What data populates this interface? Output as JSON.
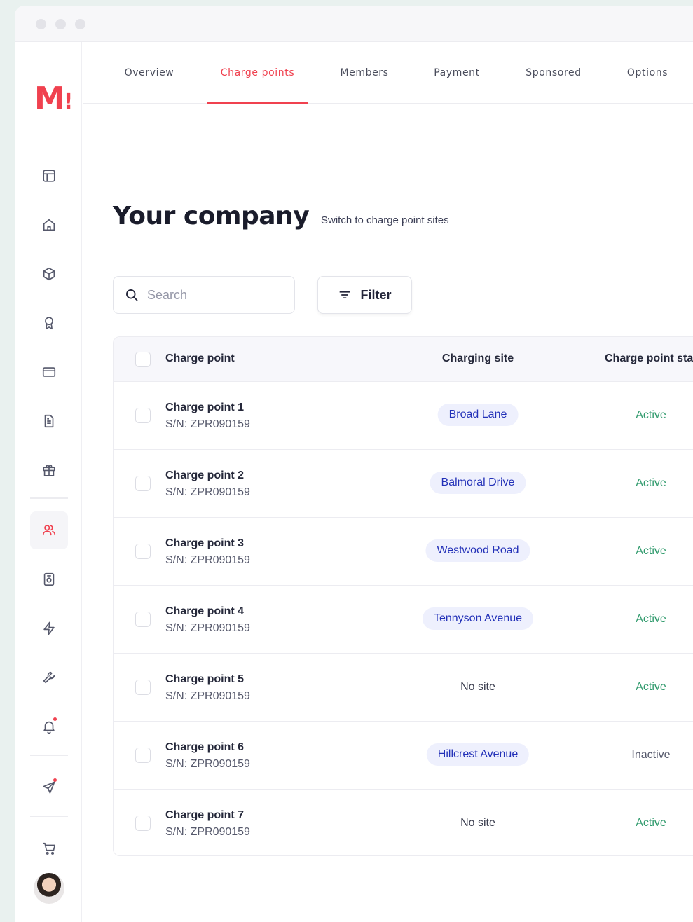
{
  "window": {
    "dot_count": 3
  },
  "brand": {
    "logo_text": "M",
    "logo_mark": "!",
    "accent_color": "#f0414f"
  },
  "sidebar": {
    "icons": [
      {
        "name": "layout-icon"
      },
      {
        "name": "home-icon"
      },
      {
        "name": "cube-icon"
      },
      {
        "name": "award-icon"
      },
      {
        "name": "card-icon"
      },
      {
        "name": "document-icon"
      },
      {
        "name": "gift-icon"
      },
      {
        "name": "users-icon",
        "active": true
      },
      {
        "name": "charger-icon"
      },
      {
        "name": "lightning-icon"
      },
      {
        "name": "wrench-icon"
      },
      {
        "name": "bell-icon",
        "notification": true
      },
      {
        "name": "send-icon",
        "notification": true
      },
      {
        "name": "cart-icon"
      }
    ]
  },
  "tabs": [
    {
      "label": "Overview",
      "active": false
    },
    {
      "label": "Charge points",
      "active": true
    },
    {
      "label": "Members",
      "active": false
    },
    {
      "label": "Payment",
      "active": false
    },
    {
      "label": "Sponsored",
      "active": false
    },
    {
      "label": "Options",
      "active": false
    }
  ],
  "page": {
    "title": "Your company",
    "switch_link": "Switch to charge point sites"
  },
  "search": {
    "placeholder": "Search",
    "value": ""
  },
  "filter": {
    "label": "Filter"
  },
  "table": {
    "columns": [
      "Charge point",
      "Charging site",
      "Charge point stat"
    ],
    "rows": [
      {
        "name": "Charge point 1",
        "serial": "S/N: ZPR090159",
        "site": "Broad Lane",
        "status": "Active"
      },
      {
        "name": "Charge point 2",
        "serial": "S/N: ZPR090159",
        "site": "Balmoral Drive",
        "status": "Active"
      },
      {
        "name": "Charge point 3",
        "serial": "S/N: ZPR090159",
        "site": "Westwood Road",
        "status": "Active"
      },
      {
        "name": "Charge point 4",
        "serial": "S/N: ZPR090159",
        "site": "Tennyson Avenue",
        "status": "Active"
      },
      {
        "name": "Charge point 5",
        "serial": "S/N: ZPR090159",
        "site": "No site",
        "status": "Active"
      },
      {
        "name": "Charge point 6",
        "serial": "S/N: ZPR090159",
        "site": "Hillcrest Avenue",
        "status": "Inactive"
      },
      {
        "name": "Charge point 7",
        "serial": "S/N: ZPR090159",
        "site": "No site",
        "status": "Active"
      }
    ]
  },
  "colors": {
    "active_status": "#2f9a6c",
    "site_chip_bg": "#eef0fd",
    "site_chip_text": "#2331b8"
  }
}
